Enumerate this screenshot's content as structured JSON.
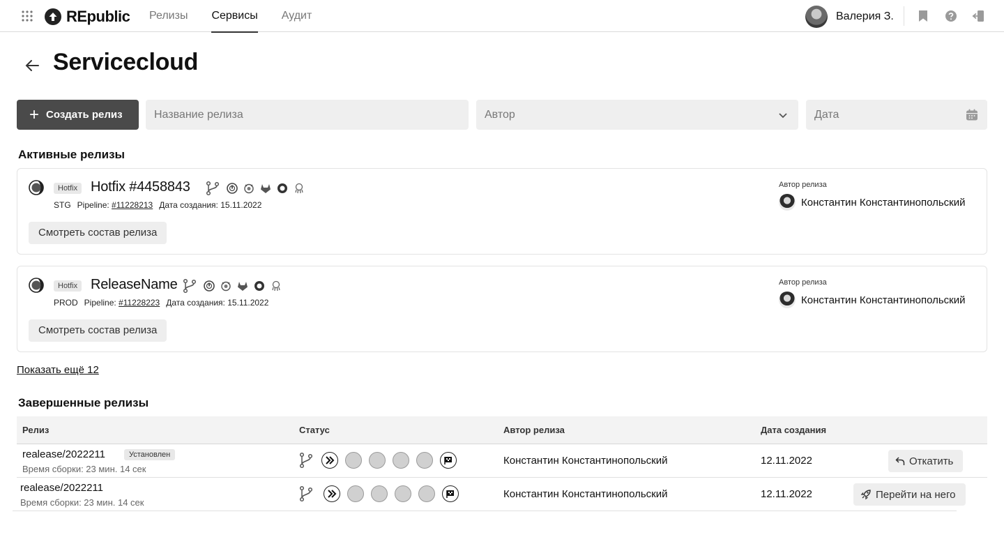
{
  "header": {
    "brand": "REpublic",
    "nav": [
      "Релизы",
      "Сервисы",
      "Аудит"
    ],
    "active_tab": "Сервисы",
    "user_name": "Валерия З."
  },
  "page": {
    "title": "Servicecloud"
  },
  "filters": {
    "create_label": "Создать релиз",
    "name_placeholder": "Название релиза",
    "author_placeholder": "Автор",
    "date_placeholder": "Дата"
  },
  "active": {
    "section_title": "Активные релизы",
    "cards": [
      {
        "tag": "Hotfix",
        "name": "Hotfix #4458843",
        "env": "STG",
        "pipeline_label": "Pipeline:",
        "pipeline": "#11228213",
        "created_label": "Дата создания:",
        "created": "15.11.2022",
        "view_label": "Смотреть состав релиза",
        "author_label": "Автор релиза",
        "author": "Константин Константинопольский"
      },
      {
        "tag": "Hotfix",
        "name": "ReleaseName",
        "env": "PROD",
        "pipeline_label": "Pipeline:",
        "pipeline": "#11228223",
        "created_label": "Дата создания:",
        "created": "15.11.2022",
        "view_label": "Смотреть состав релиза",
        "author_label": "Автор релиза",
        "author": "Константин Константинопольский"
      }
    ],
    "show_more": "Показать ещё 12"
  },
  "completed": {
    "section_title": "Завершенные релизы",
    "columns": [
      "Релиз",
      "Статус",
      "Автор релиза",
      "Дата создания"
    ],
    "rows": [
      {
        "release": "realease/2022211",
        "badge": "Установлен",
        "build_time": "Время сборки: 23 мин. 14 сек",
        "author": "Константин Константинопольский",
        "date": "12.11.2022",
        "action": "Откатить"
      },
      {
        "release": "realease/2022211",
        "badge": "",
        "build_time": "Время сборки: 23 мин. 14 сек",
        "author": "Константин Константинопольский",
        "date": "12.11.2022",
        "action": "Перейти на него"
      }
    ]
  }
}
